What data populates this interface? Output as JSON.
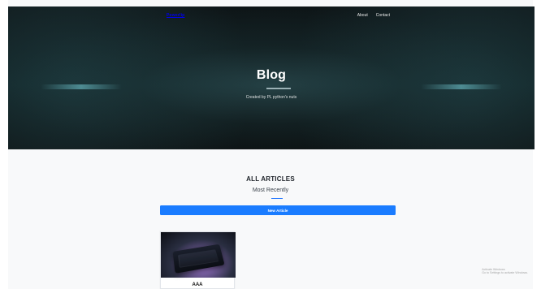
{
  "nav": {
    "brand": "Powerlip",
    "links": [
      "About",
      "Contact"
    ]
  },
  "hero": {
    "title": "Blog",
    "subtitle": "Created by PL python's nuts"
  },
  "articles": {
    "heading": "ALL ARTICLES",
    "subheading": "Most Recently",
    "new_button": "New Article",
    "items": [
      {
        "title": "AAA"
      }
    ]
  },
  "watermark": {
    "line1": "Activate Windows",
    "line2": "Go to Settings to activate Windows."
  },
  "colors": {
    "primary": "#1a7cff",
    "hero_dark": "#0e1517",
    "page_bg": "#f8f9fa"
  }
}
